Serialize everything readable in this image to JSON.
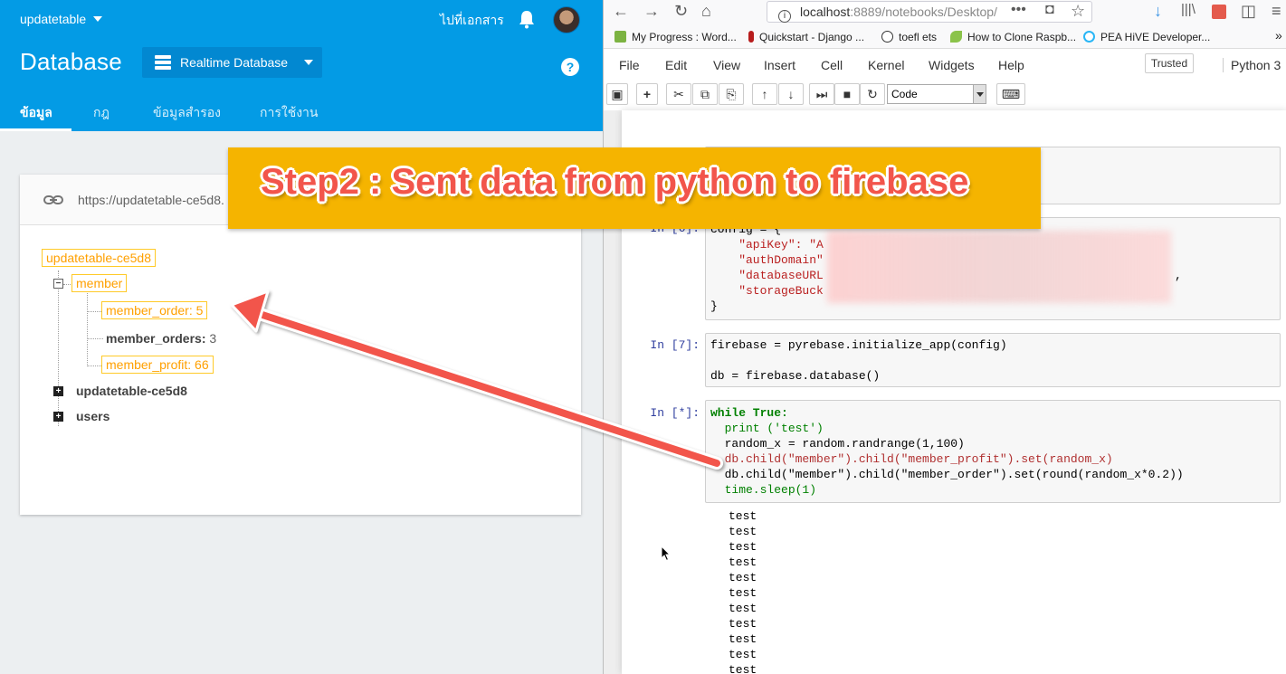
{
  "firebase": {
    "project_name": "updatetable",
    "docs_link": "ไปที่เอกสาร",
    "page_title": "Database",
    "db_selector": "Realtime Database",
    "help_glyph": "?",
    "tabs": [
      "ข้อมูล",
      "กฎ",
      "ข้อมูลสำรอง",
      "การใช้งาน"
    ],
    "active_tab": "ข้อมูล",
    "db_url": "https://updatetable-ce5d8.",
    "tree": {
      "root": "updatetable-ce5d8",
      "member": "member",
      "member_order_key": "member_order:",
      "member_order_value": "5",
      "member_orders_key": "member_orders:",
      "member_orders_value": "3",
      "member_profit_key": "member_profit:",
      "member_profit_value": "66",
      "child_updatetable": "updatetable-ce5d8",
      "child_users": "users"
    }
  },
  "browser": {
    "url_host": "localhost",
    "url_rest": ":8889/notebooks/Desktop/",
    "bookmarks": [
      "My Progress : Word...",
      "Quickstart - Django ...",
      "toefl ets",
      "How to Clone Raspb...",
      "PEA HiVE Developer..."
    ]
  },
  "jupyter": {
    "menus": [
      "File",
      "Edit",
      "View",
      "Insert",
      "Cell",
      "Kernel",
      "Widgets",
      "Help"
    ],
    "trusted": "Trusted",
    "kernel_name": "Python 3",
    "cell_type": "Code",
    "cells": [
      {
        "prompt": "In [6]:",
        "lines": [
          "config = {",
          "    \"apiKey\": \"A",
          "    \"authDomain\"",
          "    \"databaseURL",
          "    \"storageBuck",
          "}"
        ]
      },
      {
        "prompt": "In [7]:",
        "lines": [
          "firebase = pyrebase.initialize_app(config)",
          "",
          "db = firebase.database()"
        ]
      },
      {
        "prompt": "In [*]:",
        "lines": [
          "while True:",
          "  print ('test')",
          "  random_x = random.randrange(1,100)",
          "  db.child(\"member\").child(\"member_profit\").set(random_x)",
          "  db.child(\"member\").child(\"member_order\").set(round(random_x*0.2))",
          "  time.sleep(1)"
        ]
      }
    ],
    "output_lines": [
      "test",
      "test",
      "test",
      "test",
      "test",
      "test",
      "test",
      "test",
      "test",
      "test",
      "test"
    ]
  },
  "overlay": {
    "banner_text": "Step2 : Sent data from python to firebase",
    "banner_color": "#f5b400",
    "arrow_color": "#f2554b"
  }
}
